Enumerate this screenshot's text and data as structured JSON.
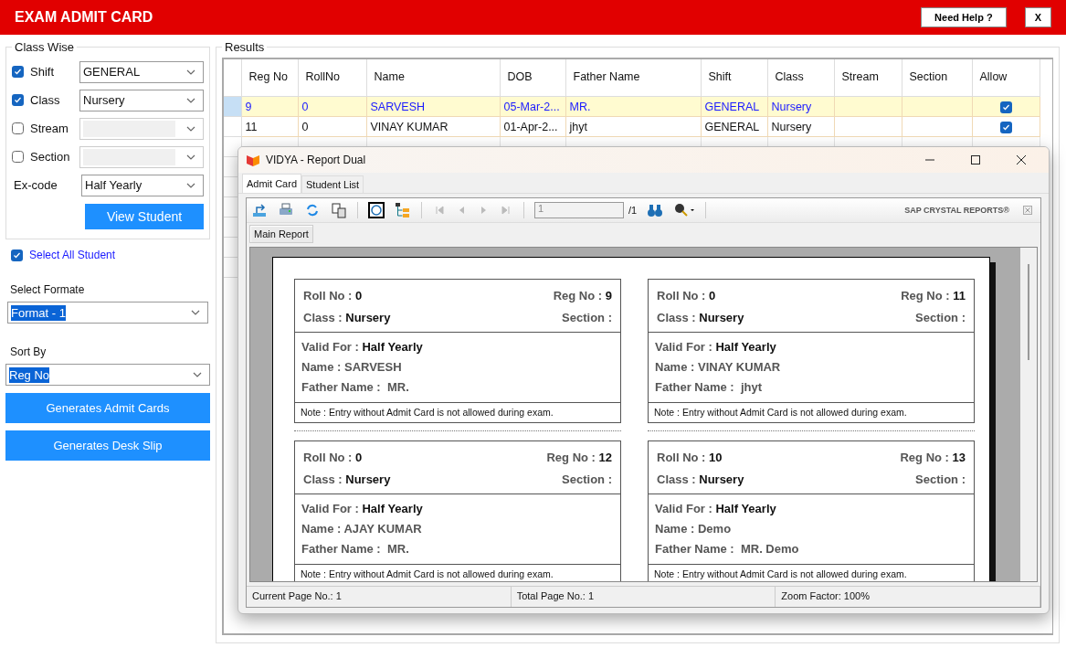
{
  "header": {
    "title": "EXAM ADMIT CARD",
    "help_button": "Need Help ?",
    "close_button": "X"
  },
  "filters": {
    "title": "Class Wise",
    "rows": [
      {
        "kind": "check",
        "label": "Shift",
        "checked": true,
        "value": "GENERAL",
        "disabled": false
      },
      {
        "kind": "check",
        "label": "Class",
        "checked": true,
        "value": "Nursery",
        "disabled": false
      },
      {
        "kind": "check",
        "label": "Stream",
        "checked": false,
        "disabled": true
      },
      {
        "kind": "check",
        "label": "Section",
        "checked": false,
        "disabled": true
      },
      {
        "kind": "plain",
        "label": "Ex-code",
        "value": "Half Yearly",
        "disabled": false
      }
    ],
    "view_button": "View Student"
  },
  "select_all": {
    "label": "Select All Student",
    "checked": true
  },
  "format": {
    "label": "Select Formate",
    "value": "Format - 1",
    "highlighted": true
  },
  "sort": {
    "label": "Sort By",
    "value": "Reg No",
    "highlighted": true
  },
  "buttons": [
    "Generates Admit Cards",
    "Generates Desk Slip"
  ],
  "results": {
    "title": "Results",
    "columns": [
      "Reg No",
      "RollNo",
      "Name",
      "DOB",
      "Father Name",
      "Shift",
      "Class",
      "Stream",
      "Section",
      "Allow"
    ],
    "rows": [
      {
        "cells": [
          "9",
          "0",
          "SARVESH",
          "05-Mar-2...",
          "MR.",
          "GENERAL",
          "Nursery",
          "",
          ""
        ],
        "allow": true,
        "selected": true
      },
      {
        "cells": [
          "11",
          "0",
          "VINAY KUMAR",
          "01-Apr-2...",
          "jhyt",
          "GENERAL",
          "Nursery",
          "",
          ""
        ],
        "allow": true,
        "selected": false
      }
    ]
  },
  "report_window": {
    "title": "VIDYA - Report Dual",
    "tabs": [
      {
        "label": "Admit Card",
        "selected": true
      },
      {
        "label": "Student List",
        "selected": false
      }
    ],
    "page_field": "1",
    "page_total": "/1",
    "brand": "SAP CRYSTAL REPORTS®",
    "report_tab": "Main Report",
    "cards": [
      {
        "roll": "Roll No : **0**",
        "reg": "Reg No : **9**",
        "class": "Class : **Nursery**",
        "section": "Section :",
        "valid_for": "Valid For : **Half Yearly**",
        "name": "Name : SARVESH",
        "father": "Father Name :  MR.",
        "note": "Note : Entry without Admit Card is not allowed during exam."
      },
      {
        "roll": "Roll No : **0**",
        "reg": "Reg No : **11**",
        "class": "Class : **Nursery**",
        "section": "Section :",
        "valid_for": "Valid For : **Half Yearly**",
        "name": "Name : VINAY KUMAR",
        "father": "Father Name :  jhyt",
        "note": "Note : Entry without Admit Card is not allowed during exam."
      },
      {
        "roll": "Roll No : **0**",
        "reg": "Reg No : **12**",
        "class": "Class : **Nursery**",
        "section": "Section :",
        "valid_for": "Valid For : **Half Yearly**",
        "name": "Name : AJAY KUMAR",
        "father": "Father Name :  MR.",
        "note": "Note : Entry without Admit Card is not allowed during exam."
      },
      {
        "roll": "Roll No : **10**",
        "reg": "Reg No : **13**",
        "class": "Class : **Nursery**",
        "section": "Section :",
        "valid_for": "Valid For : **Half Yearly**",
        "name": "Name : Demo",
        "father": "Father Name :  MR. Demo",
        "note": "Note : Entry without Admit Card is not allowed during exam."
      }
    ],
    "status": [
      "Current Page No.: 1",
      "Total Page No.: 1",
      "Zoom Factor: 100%"
    ]
  }
}
